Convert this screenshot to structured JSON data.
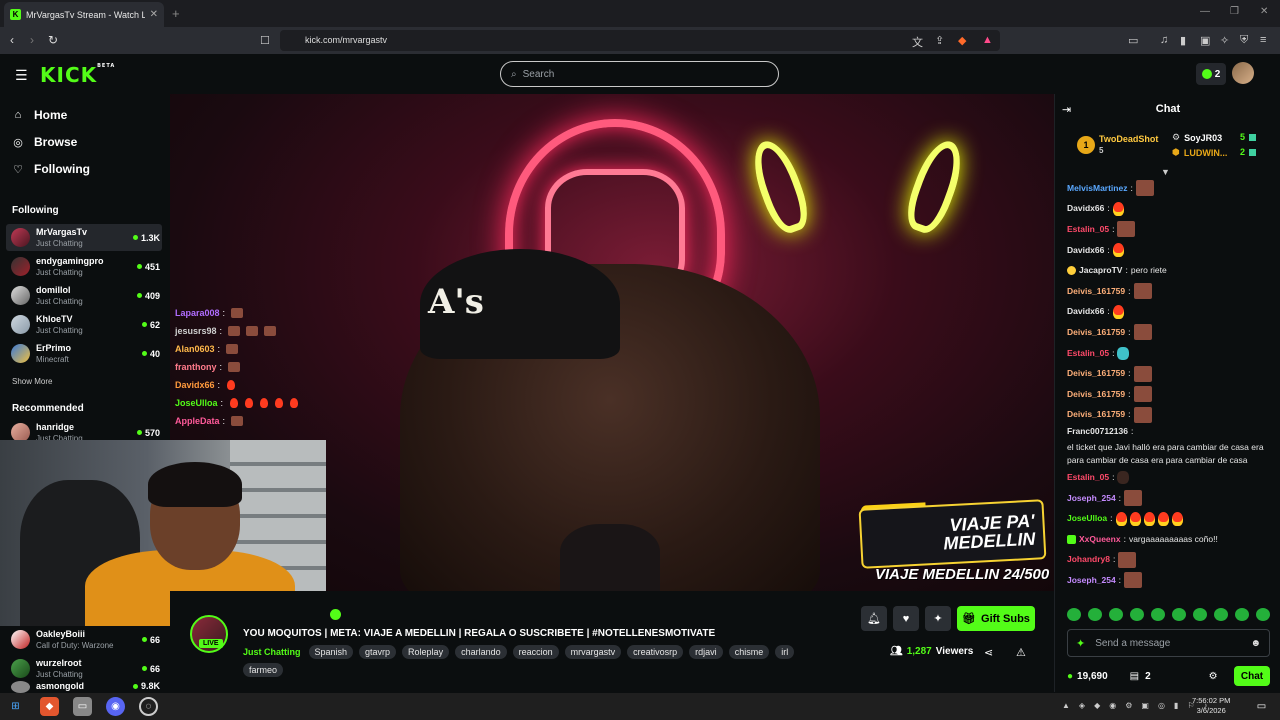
{
  "browser": {
    "tab_title": "MrVargasTv Stream - Watch L",
    "tab_close": "✕",
    "new_tab": "+",
    "url": "kick.com/mrvargastv"
  },
  "header": {
    "logo": "KICK",
    "logo_sup": "BETA",
    "search_placeholder": "Search",
    "kick_count": "2"
  },
  "nav": {
    "items": [
      {
        "label": "Home",
        "icon": "home-icon"
      },
      {
        "label": "Browse",
        "icon": "browse-icon"
      },
      {
        "label": "Following",
        "icon": "heart-icon"
      }
    ]
  },
  "sidebar": {
    "following_title": "Following",
    "following": [
      {
        "name": "MrVargasTv",
        "category": "Just Chatting",
        "viewers": "1.3K"
      },
      {
        "name": "endygamingpro",
        "category": "Just Chatting",
        "viewers": "451"
      },
      {
        "name": "domillol",
        "category": "Just Chatting",
        "viewers": "409"
      },
      {
        "name": "KhloeTV",
        "category": "Just Chatting",
        "viewers": "62"
      },
      {
        "name": "ErPrimo",
        "category": "Minecraft",
        "viewers": "40"
      }
    ],
    "show_more": "Show More",
    "recommended_title": "Recommended",
    "recommended": [
      {
        "name": "hanridge",
        "category": "Just Chatting",
        "viewers": "570"
      },
      {
        "name": "OakleyBoiii",
        "category": "Call of Duty: Warzone",
        "viewers": "66"
      },
      {
        "name": "wurzelroot",
        "category": "Just Chatting",
        "viewers": "66"
      },
      {
        "name": "asmongold",
        "category": "",
        "viewers": "9.8K"
      }
    ]
  },
  "overlay_chat": [
    {
      "user": "Lapara008",
      "color": "#b06dff"
    },
    {
      "user": "jesusrs98",
      "color": "#cfcfcf"
    },
    {
      "user": "Alan0603",
      "color": "#ffb84a"
    },
    {
      "user": "franthony",
      "color": "#ff7b8b"
    },
    {
      "user": "Davidx66",
      "color": "#ff9a3d"
    },
    {
      "user": "JoseUlloa",
      "color": "#53fc18"
    },
    {
      "user": "AppleData",
      "color": "#ff5a9a"
    }
  ],
  "video_overlay": {
    "cap_logo": "A's",
    "meta_title": "VIAJE PA' MEDELLIN",
    "meta_count": "VIAJE MEDELLIN 24/500"
  },
  "stream": {
    "title": "YOU MOQUITOS | META: VIAJE A MEDELLIN | REGALA O SUSCRIBETE | #NOTELLENESMOTIVATE",
    "category": "Just Chatting",
    "tags": [
      "Spanish",
      "gtavrp",
      "Roleplay",
      "charlando",
      "reaccion",
      "mrvargastv",
      "creativosrp",
      "rdjavi",
      "chisme",
      "irl",
      "farmeo"
    ],
    "live_label": "LIVE",
    "viewers": "1,287",
    "viewers_label": "Viewers",
    "gift_label": "Gift Subs"
  },
  "chat": {
    "title": "Chat",
    "gifters": [
      {
        "name": "TwoDeadShot",
        "count": "5",
        "rank": "1"
      },
      {
        "name": "SoyJR03",
        "count": "5"
      },
      {
        "name": "LUDWIN...",
        "count": "2"
      }
    ],
    "messages": [
      {
        "user": "MelvisMartinez",
        "color": "#5aa8ff",
        "text": "",
        "emotes": "em1"
      },
      {
        "user": "Davidx66",
        "color": "#e6e6e6",
        "text": "",
        "emotes": "fire1"
      },
      {
        "user": "Estalin_05",
        "color": "#ff4a6a",
        "text": "",
        "emotes": "em1"
      },
      {
        "user": "Davidx66",
        "color": "#e6e6e6",
        "text": "",
        "emotes": "fire1"
      },
      {
        "user": "JacaproTV",
        "color": "#e6e6e6",
        "text": "pero riete",
        "emotes": "moon"
      },
      {
        "user": "Deivis_161759",
        "color": "#ffb07a",
        "text": "",
        "emotes": "em1"
      },
      {
        "user": "Davidx66",
        "color": "#e6e6e6",
        "text": "",
        "emotes": "fire1"
      },
      {
        "user": "Deivis_161759",
        "color": "#ffb07a",
        "text": "",
        "emotes": "em1"
      },
      {
        "user": "Estalin_05",
        "color": "#ff4a6a",
        "text": "",
        "emotes": "teal"
      },
      {
        "user": "Deivis_161759",
        "color": "#ffb07a",
        "text": "",
        "emotes": "em1"
      },
      {
        "user": "Deivis_161759",
        "color": "#ffb07a",
        "text": "",
        "emotes": "em1"
      },
      {
        "user": "Deivis_161759",
        "color": "#ffb07a",
        "text": "",
        "emotes": "em1"
      },
      {
        "user": "Franc00712136",
        "color": "#e6e6e6",
        "text": "el ticket que Javi halló era para cambiar de casa era para cambiar de casa era para cambiar de casa",
        "emotes": ""
      },
      {
        "user": "Estalin_05",
        "color": "#ff4a6a",
        "text": "",
        "emotes": "dark"
      },
      {
        "user": "Joseph_254",
        "color": "#c58bff",
        "text": "",
        "emotes": "em1"
      },
      {
        "user": "JoseUlloa",
        "color": "#53fc18",
        "text": "",
        "emotes": "fire5"
      },
      {
        "user": "XxQueenx",
        "color": "#ff5a9a",
        "text": "vargaaaaaaaaas coño!!",
        "emotes": "badge"
      },
      {
        "user": "Johandry8",
        "color": "#ff4a6a",
        "text": "",
        "emotes": "em1"
      },
      {
        "user": "Joseph_254",
        "color": "#c58bff",
        "text": "",
        "emotes": "em1"
      }
    ],
    "input_placeholder": "Send a message",
    "kicks": "19,690",
    "gift_count": "2",
    "send_label": "Chat"
  },
  "taskbar": {
    "time": "7:56:02 PM",
    "date": "3/6/2026"
  }
}
